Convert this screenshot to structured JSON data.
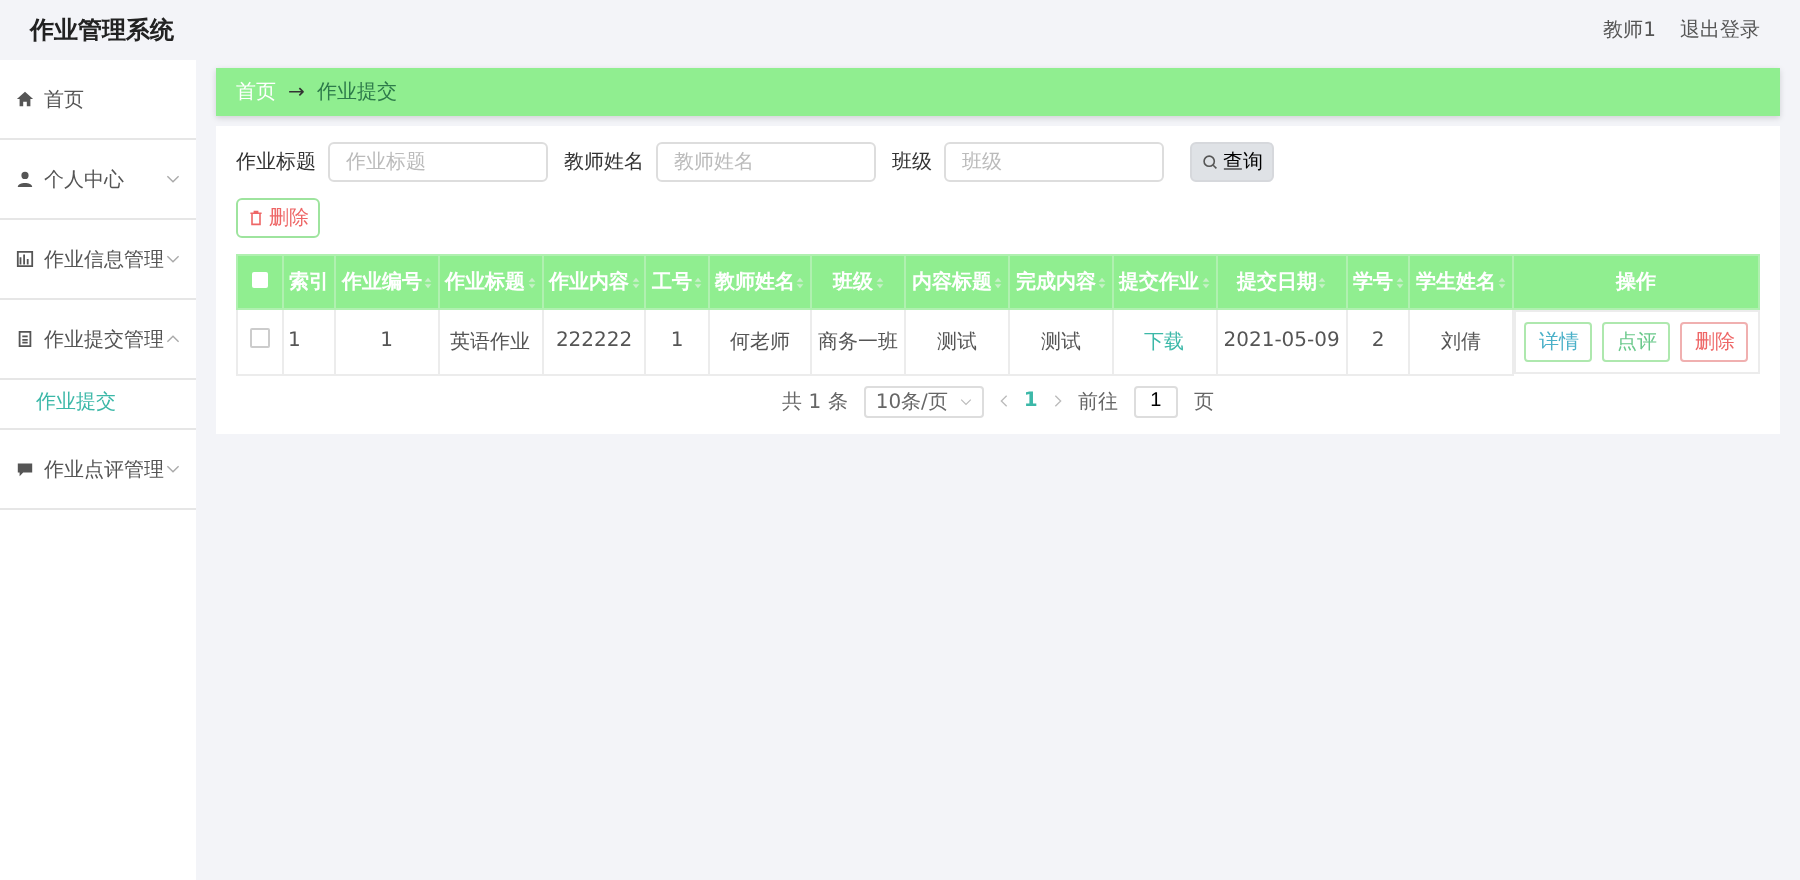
{
  "header": {
    "title": "作业管理系统",
    "user": "教师1",
    "logout": "退出登录"
  },
  "sidebar": {
    "items": [
      {
        "label": "首页",
        "kind": "home",
        "expandable": false
      },
      {
        "label": "个人中心",
        "kind": "user",
        "expandable": true,
        "expanded": false
      },
      {
        "label": "作业信息管理",
        "kind": "chart",
        "expandable": true,
        "expanded": false
      },
      {
        "label": "作业提交管理",
        "kind": "doc",
        "expandable": true,
        "expanded": true,
        "children": [
          {
            "label": "作业提交",
            "selected": true
          }
        ]
      },
      {
        "label": "作业点评管理",
        "kind": "chat",
        "expandable": true,
        "expanded": false
      }
    ]
  },
  "breadcrumb": {
    "separator": "→",
    "items": [
      "首页",
      "作业提交"
    ]
  },
  "search": {
    "fields": [
      {
        "label": "作业标题",
        "placeholder": "作业标题"
      },
      {
        "label": "教师姓名",
        "placeholder": "教师姓名"
      },
      {
        "label": "班级",
        "placeholder": "班级"
      }
    ],
    "button": "查询"
  },
  "delete_button": "删除",
  "table": {
    "select_all_checked": false,
    "columns": [
      {
        "label": "索引",
        "sortable": false
      },
      {
        "label": "作业编号",
        "sortable": true
      },
      {
        "label": "作业标题",
        "sortable": true
      },
      {
        "label": "作业内容",
        "sortable": true
      },
      {
        "label": "工号",
        "sortable": true
      },
      {
        "label": "教师姓名",
        "sortable": true
      },
      {
        "label": "班级",
        "sortable": true
      },
      {
        "label": "内容标题",
        "sortable": true
      },
      {
        "label": "完成内容",
        "sortable": true
      },
      {
        "label": "提交作业",
        "sortable": true
      },
      {
        "label": "提交日期",
        "sortable": true
      },
      {
        "label": "学号",
        "sortable": true
      },
      {
        "label": "学生姓名",
        "sortable": true
      },
      {
        "label": "操作",
        "sortable": false
      }
    ],
    "rows": [
      {
        "checked": false,
        "cells": [
          {
            "text": "1",
            "kind": "text"
          },
          {
            "text": "1",
            "kind": "text"
          },
          {
            "text": "英语作业",
            "kind": "text"
          },
          {
            "text": "222222",
            "kind": "text"
          },
          {
            "text": "1",
            "kind": "text"
          },
          {
            "text": "何老师",
            "kind": "text"
          },
          {
            "text": "商务一班",
            "kind": "text"
          },
          {
            "text": "测试",
            "kind": "text"
          },
          {
            "text": "测试",
            "kind": "text"
          },
          {
            "text": "下载",
            "kind": "link"
          },
          {
            "text": "2021-05-09",
            "kind": "text"
          },
          {
            "text": "2",
            "kind": "text"
          },
          {
            "text": "刘倩",
            "kind": "text"
          }
        ],
        "actions": [
          {
            "label": "详情",
            "kind": "info"
          },
          {
            "label": "点评",
            "kind": "success"
          },
          {
            "label": "删除",
            "kind": "danger"
          }
        ]
      }
    ]
  },
  "pagination": {
    "total": "共 1 条",
    "page_size": "10条/页",
    "pages": [
      {
        "label": "1",
        "selected": true
      }
    ],
    "goto_label": "前往",
    "goto_value": "1",
    "goto_suffix": "页"
  }
}
